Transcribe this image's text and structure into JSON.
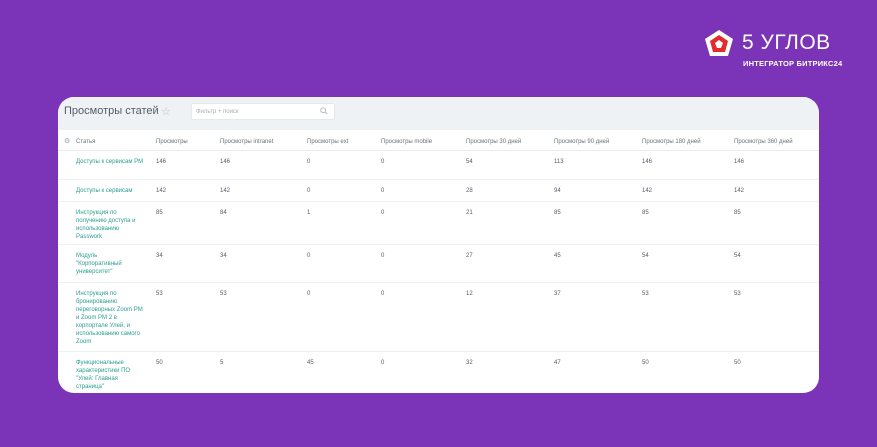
{
  "brand": {
    "name": "5 УГЛОВ",
    "subtitle": "ИНТЕГРАТОР БИТРИКС24"
  },
  "page": {
    "title": "Просмотры статей",
    "star_icon": "star-icon"
  },
  "search": {
    "placeholder": "Фильтр + поиск",
    "icon": "search-icon"
  },
  "table": {
    "columns": [
      "Статья",
      "Просмотры",
      "Просмотры intranet",
      "Просмотры ext",
      "Просмотры mobile",
      "Просмотры 30 дней",
      "Просмотры 90 дней",
      "Просмотры 180 дней",
      "Просмотры 360 дней"
    ],
    "rows": [
      {
        "article": "Доступы к сервисам РМ",
        "values": [
          "146",
          "146",
          "0",
          "0",
          "54",
          "113",
          "146",
          "146"
        ]
      },
      {
        "article": "Доступы к сервисам",
        "values": [
          "142",
          "142",
          "0",
          "0",
          "28",
          "94",
          "142",
          "142"
        ]
      },
      {
        "article": "Инструкция по получению доступа и использованию Passwork",
        "values": [
          "85",
          "84",
          "1",
          "0",
          "21",
          "85",
          "85",
          "85"
        ]
      },
      {
        "article": "Модуль \"Корпоративный университет\"",
        "values": [
          "34",
          "34",
          "0",
          "0",
          "27",
          "45",
          "54",
          "54"
        ]
      },
      {
        "article": "Инструкция по бронированию переговорных Zoom PM и Zoom PM 2 в корпортале Улей, и использованию самого Zoom",
        "values": [
          "53",
          "53",
          "0",
          "0",
          "12",
          "37",
          "53",
          "53"
        ]
      },
      {
        "article": "Функциональные характеристики ПО \"Улей: Главная страница\"",
        "values": [
          "50",
          "5",
          "45",
          "0",
          "32",
          "47",
          "50",
          "50"
        ]
      }
    ]
  }
}
